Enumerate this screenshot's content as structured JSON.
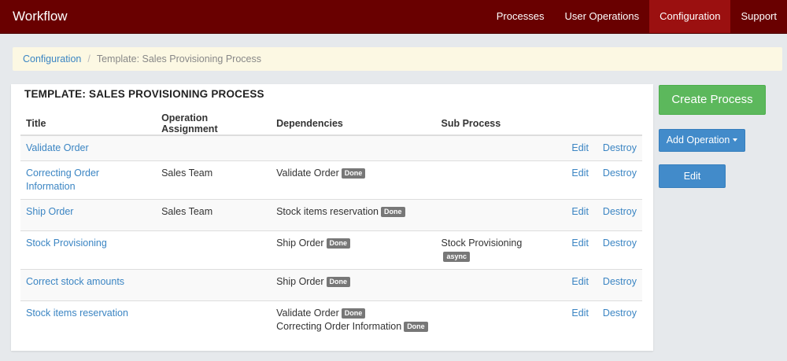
{
  "navbar": {
    "brand": "Workflow",
    "items": [
      {
        "label": "Processes"
      },
      {
        "label": "User Operations"
      },
      {
        "label": "Configuration"
      },
      {
        "label": "Support"
      }
    ]
  },
  "breadcrumb": {
    "parent": "Configuration",
    "separator": "/",
    "current": "Template: Sales Provisioning Process"
  },
  "panel": {
    "title": "TEMPLATE: SALES PROVISIONING PROCESS",
    "columns": {
      "title": "Title",
      "assignment": "Operation Assignment",
      "dependencies": "Dependencies",
      "subprocess": "Sub Process"
    },
    "rows": [
      {
        "title": "Validate Order",
        "assignment": "",
        "deps": [],
        "subprocess": "",
        "subprocess_badge": "",
        "edit": "Edit",
        "destroy": "Destroy"
      },
      {
        "title": "Correcting Order Information",
        "assignment": "Sales Team",
        "deps": [
          {
            "name": "Validate Order",
            "badge": "Done"
          }
        ],
        "subprocess": "",
        "subprocess_badge": "",
        "edit": "Edit",
        "destroy": "Destroy"
      },
      {
        "title": "Ship Order",
        "assignment": "Sales Team",
        "deps": [
          {
            "name": "Stock items reservation",
            "badge": "Done"
          }
        ],
        "subprocess": "",
        "subprocess_badge": "",
        "edit": "Edit",
        "destroy": "Destroy"
      },
      {
        "title": "Stock Provisioning",
        "assignment": "",
        "deps": [
          {
            "name": "Ship Order",
            "badge": "Done"
          }
        ],
        "subprocess": "Stock Provisioning",
        "subprocess_badge": "async",
        "edit": "Edit",
        "destroy": "Destroy"
      },
      {
        "title": "Correct stock amounts",
        "assignment": "",
        "deps": [
          {
            "name": "Ship Order",
            "badge": "Done"
          }
        ],
        "subprocess": "",
        "subprocess_badge": "",
        "edit": "Edit",
        "destroy": "Destroy"
      },
      {
        "title": "Stock items reservation",
        "assignment": "",
        "deps": [
          {
            "name": "Validate Order",
            "badge": "Done"
          },
          {
            "name": "Correcting Order Information",
            "badge": "Done"
          }
        ],
        "subprocess": "",
        "subprocess_badge": "",
        "edit": "Edit",
        "destroy": "Destroy"
      }
    ]
  },
  "sidebar": {
    "create_label": "Create Process",
    "add_operation_label": "Add Operation",
    "edit_label": "Edit"
  },
  "colors": {
    "navbar": "#690000",
    "nav_active": "#9b1010",
    "link": "#3b85c3",
    "success": "#5cb85c",
    "primary": "#428bca",
    "badge": "#777777",
    "breadcrumb_bg": "#fcf8e3"
  }
}
